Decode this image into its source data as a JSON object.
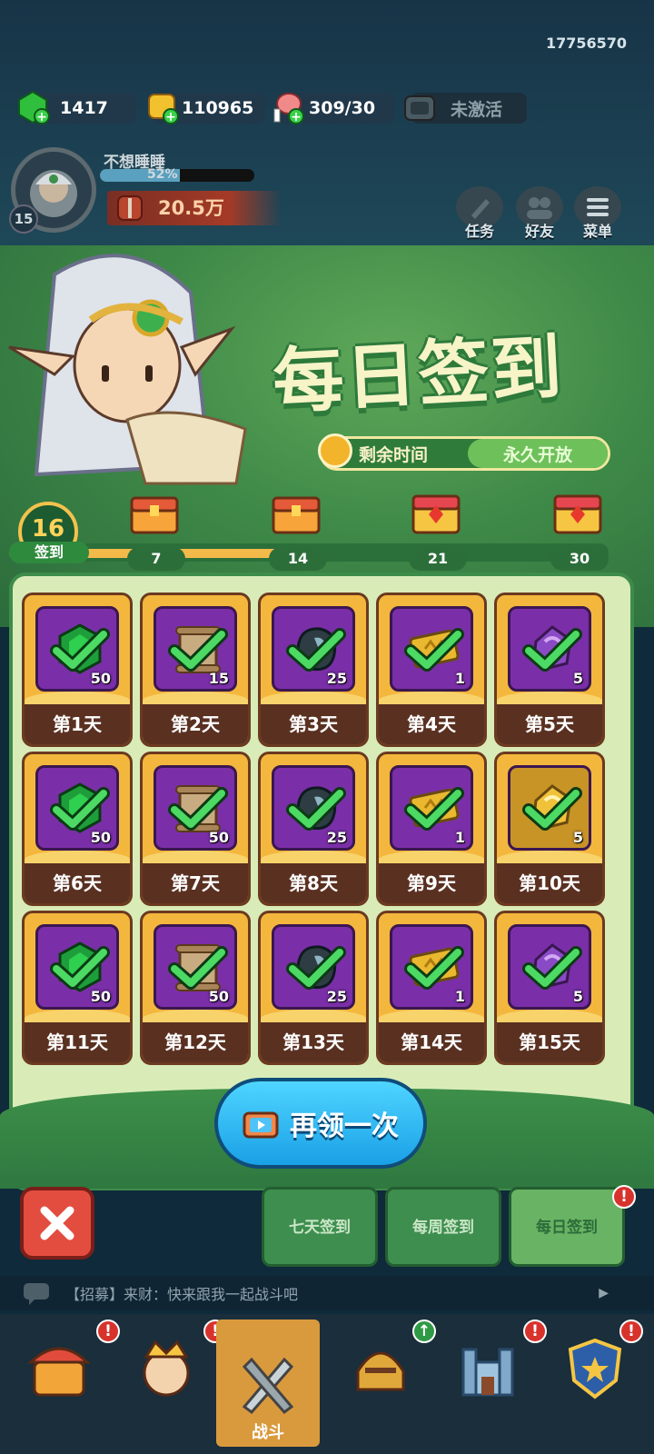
{
  "uid": "17756570",
  "resources": [
    {
      "name": "gem",
      "value": "1417",
      "icon": "green-gem-icon"
    },
    {
      "name": "gold",
      "value": "110965",
      "icon": "gold-coin-icon"
    },
    {
      "name": "meat",
      "value": "309/30",
      "icon": "meat-icon"
    },
    {
      "name": "pass",
      "value": "未激活",
      "icon": "tv-pass-icon"
    }
  ],
  "profile": {
    "name": "不想睡睡",
    "level": "15",
    "xp_text": "52%",
    "xp_fraction": 0.52,
    "power": "20.5万"
  },
  "side_buttons": [
    {
      "label": "任务",
      "icon": "quest-icon"
    },
    {
      "label": "好友",
      "icon": "friends-icon"
    },
    {
      "label": "菜单",
      "icon": "menu-icon"
    }
  ],
  "event": {
    "title": "每日签到",
    "time_label": "剩余时间",
    "time_value": "永久开放",
    "signed_days": "16",
    "signed_label": "签到",
    "progress_fraction": 0.5,
    "milestones": [
      "7",
      "14",
      "21",
      "30"
    ]
  },
  "days": [
    {
      "label": "第1天",
      "count": "50",
      "item": "green-gem"
    },
    {
      "label": "第2天",
      "count": "15",
      "item": "scroll"
    },
    {
      "label": "第3天",
      "count": "25",
      "item": "ore"
    },
    {
      "label": "第4天",
      "count": "1",
      "item": "ticket"
    },
    {
      "label": "第5天",
      "count": "5",
      "item": "purple-stone"
    },
    {
      "label": "第6天",
      "count": "50",
      "item": "green-gem"
    },
    {
      "label": "第7天",
      "count": "50",
      "item": "scroll"
    },
    {
      "label": "第8天",
      "count": "25",
      "item": "ore"
    },
    {
      "label": "第9天",
      "count": "1",
      "item": "ticket"
    },
    {
      "label": "第10天",
      "count": "5",
      "item": "gold-stone"
    },
    {
      "label": "第11天",
      "count": "50",
      "item": "green-gem"
    },
    {
      "label": "第12天",
      "count": "50",
      "item": "scroll"
    },
    {
      "label": "第13天",
      "count": "25",
      "item": "ore"
    },
    {
      "label": "第14天",
      "count": "1",
      "item": "ticket"
    },
    {
      "label": "第15天",
      "count": "5",
      "item": "purple-stone"
    }
  ],
  "retry_label": "再领一次",
  "tabs": [
    {
      "label": "七天签到",
      "active": false
    },
    {
      "label": "每周签到",
      "active": false
    },
    {
      "label": "每日签到",
      "active": true
    }
  ],
  "chat": "【招募】来财：快来跟我一起战斗吧",
  "nav": [
    {
      "icon": "shop-icon",
      "label": ""
    },
    {
      "icon": "heroes-icon",
      "label": ""
    },
    {
      "icon": "battle-icon",
      "label": "战斗"
    },
    {
      "icon": "equipment-icon",
      "label": ""
    },
    {
      "icon": "castle-icon",
      "label": ""
    },
    {
      "icon": "guild-icon",
      "label": ""
    }
  ],
  "colors": {
    "green_panel": "#3e8c4a",
    "cell_gold": "#f4b73d",
    "cell_purple": "#7a2fa8",
    "retry_blue": "#1aa0e6"
  }
}
